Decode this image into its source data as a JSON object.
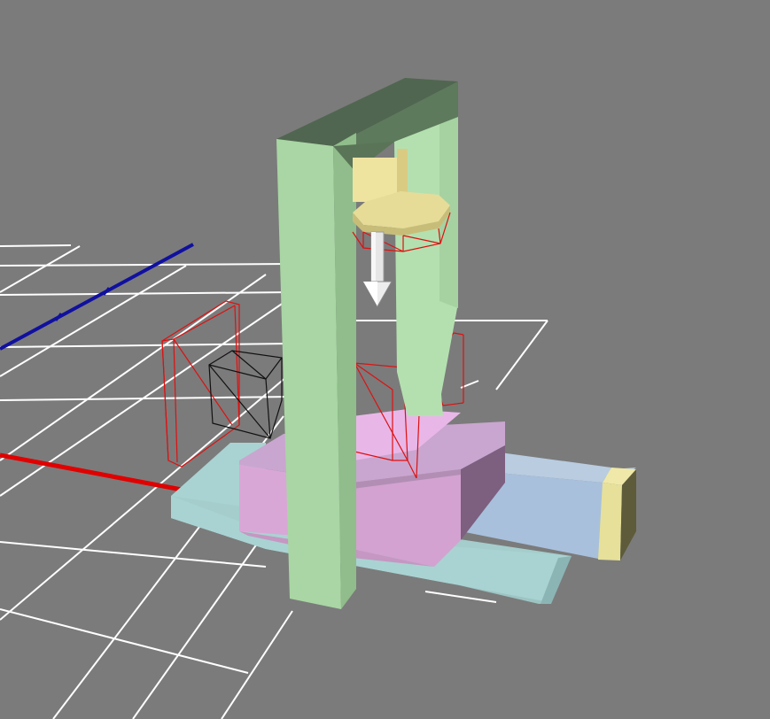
{
  "viewport": {
    "background": "#7b7b7b",
    "grid_color": "#ffffff"
  },
  "axes": {
    "x_axis_color": "#e00000",
    "z_axis_color": "#1010a0"
  },
  "selection": {
    "wire_color": "#dd1111",
    "helper_color": "#111111"
  },
  "objects": {
    "gantry_frame_color": "#a9d6a4",
    "spindle_head_color": "#efe3a0",
    "tool_arrow_color": "#e6e6e6",
    "table_plate_color": "#a9d3d2",
    "saddle_color": "#d9a7d6",
    "slide_carriage_color": "#a8c0dc",
    "slide_end_cap_color": "#e6e09a"
  }
}
